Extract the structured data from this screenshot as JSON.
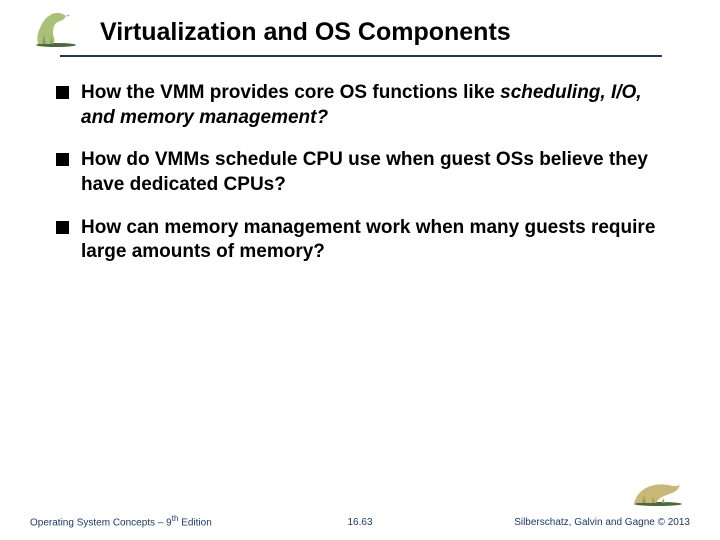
{
  "title": "Virtualization and OS Components",
  "bullets": [
    {
      "plain1": "How the VMM provides core OS functions like ",
      "italic": "scheduling, I/O, and memory management?",
      "plain2": ""
    },
    {
      "plain1": "How do VMMs schedule CPU use when guest OSs believe they have dedicated CPUs?",
      "italic": "",
      "plain2": ""
    },
    {
      "plain1": "How can memory management work when many guests require large amounts of memory?",
      "italic": "",
      "plain2": ""
    }
  ],
  "footer": {
    "left_pre": "Operating System Concepts – 9",
    "left_sup": "th",
    "left_post": " Edition",
    "center": "16.63",
    "right": "Silberschatz, Galvin and Gagne © 2013"
  },
  "colors": {
    "accent": "#1a3a6e"
  }
}
